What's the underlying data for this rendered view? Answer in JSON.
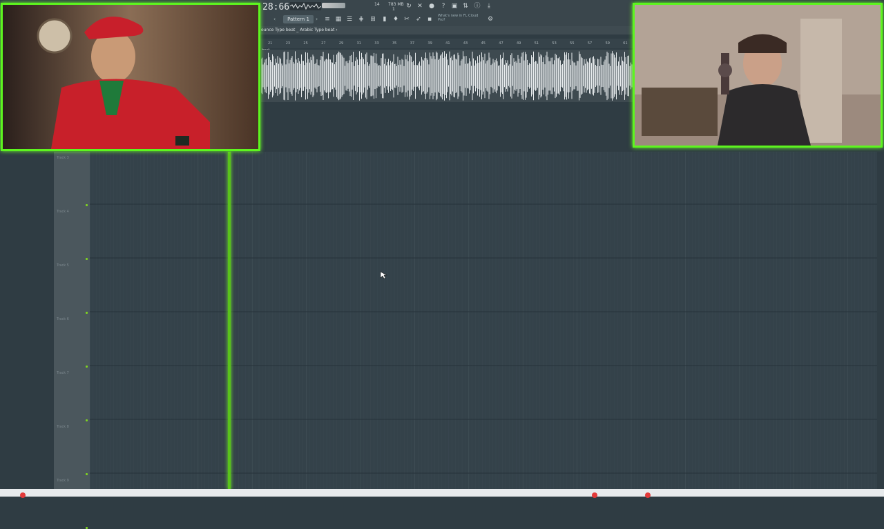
{
  "toolbar": {
    "time": "28:66",
    "memory_1": "14",
    "memory_2": "783 MB",
    "memory_3": "1",
    "pattern_label": "Pattern 1",
    "pattern_prev": "‹",
    "pattern_next": "›",
    "news_text": "What's new in FL Cloud Pro?",
    "icons": [
      "metronome-icon",
      "wait-icon",
      "record-icon",
      "loop-icon",
      "help-icon",
      "save-icon",
      "plugin-icon",
      "info-icon",
      "download-icon"
    ],
    "tool_icons": [
      "mixer-icon",
      "channel-rack-icon",
      "piano-roll-icon",
      "playlist-icon",
      "browser-icon",
      "plugin-picker-icon",
      "touch-icon",
      "cut-icon",
      "brush-icon",
      "stamp-icon"
    ]
  },
  "breadcrumb": {
    "text": "ounce Type beat _ Arabic Type beat ›"
  },
  "ruler": {
    "ticks": [
      "21",
      "23",
      "25",
      "27",
      "29",
      "31",
      "33",
      "35",
      "37",
      "39",
      "41",
      "43",
      "45",
      "47",
      "49",
      "51",
      "53",
      "55",
      "57",
      "59",
      "61"
    ]
  },
  "clip": {
    "label": "beat"
  },
  "playlist": {
    "tracks": [
      {
        "label": "Track 3"
      },
      {
        "label": "Track 4"
      },
      {
        "label": "Track 5"
      },
      {
        "label": "Track 6"
      },
      {
        "label": "Track 7"
      },
      {
        "label": "Track 8"
      },
      {
        "label": "Track 9"
      }
    ]
  },
  "colors": {
    "accent_green": "#5df51f",
    "playhead": "#59c41a",
    "background": "#2f3c43"
  }
}
